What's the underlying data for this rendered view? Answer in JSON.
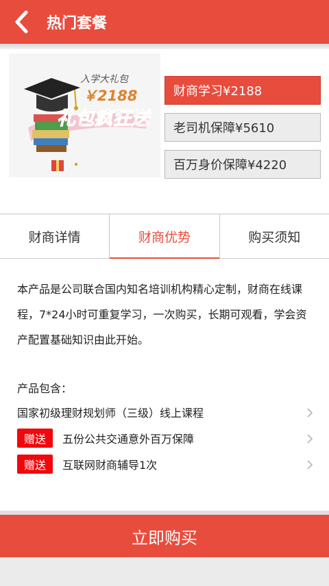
{
  "header": {
    "title": "热门套餐",
    "background_color": "#e84c3d",
    "back_icon": "chevron-left-icon"
  },
  "product_image": {
    "promo_text": "入学大礼包",
    "price_text": "￥2188",
    "slogan_text": "礼包疯狂送"
  },
  "packages": [
    {
      "label": "财商学习¥2188",
      "selected": true
    },
    {
      "label": "老司机保障¥5610",
      "selected": false
    },
    {
      "label": "百万身价保障¥4220",
      "selected": false
    }
  ],
  "tabs": [
    {
      "label": "财商详情",
      "active": false
    },
    {
      "label": "财商优势",
      "active": true
    },
    {
      "label": "购买须知",
      "active": false
    }
  ],
  "description": "本产品是公司联合国内知名培训机构精心定制，财商在线课程，7*24小时可重复学习，一次购买，长期可观看，学会资产配置基础知识由此开始。",
  "includes": {
    "title": "产品包含：",
    "gift_badge": "赠送",
    "items": [
      {
        "text": "国家初级理财规划师（三级）线上课程",
        "gift": false
      },
      {
        "text": "五份公共交通意外百万保障",
        "gift": true
      },
      {
        "text": "互联网财商辅导1次",
        "gift": true
      }
    ]
  },
  "buy_button": {
    "label": "立即购买"
  },
  "colors": {
    "accent": "#e84c3d",
    "gift_badge": "#f0080c"
  }
}
